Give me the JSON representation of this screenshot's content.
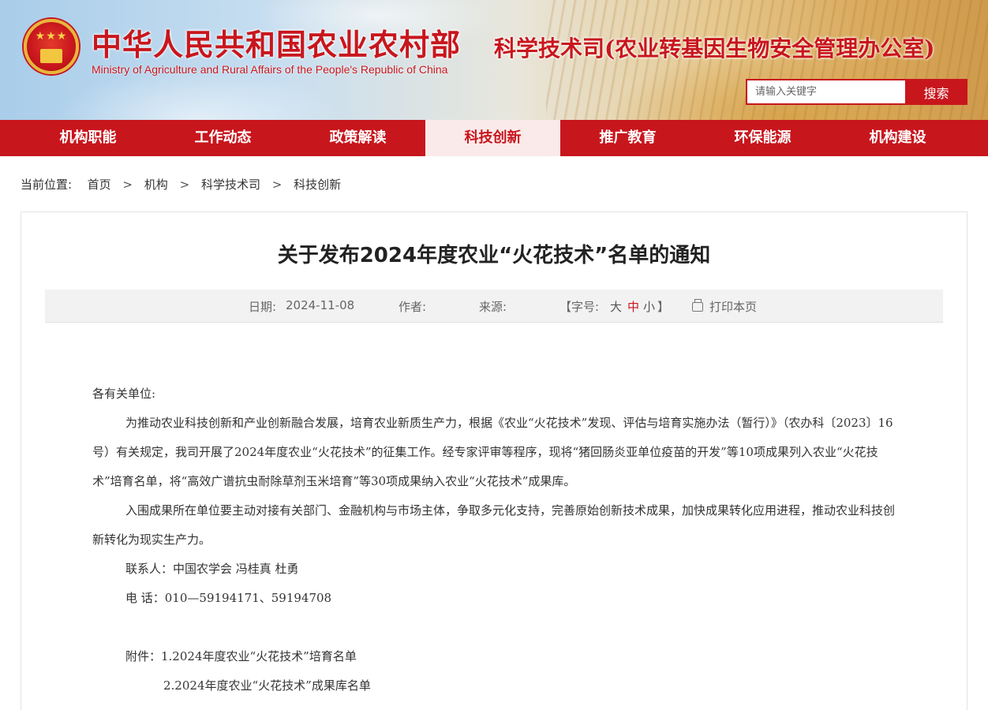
{
  "header": {
    "site_title": "中华人民共和国农业农村部",
    "site_subtitle": "Ministry of Agriculture and Rural Affairs of the People's Republic of China",
    "dept_title": "科学技术司(农业转基因生物安全管理办公室)",
    "search": {
      "placeholder": "请输入关键字",
      "button_label": "搜索"
    }
  },
  "nav": {
    "items": [
      {
        "label": "机构职能"
      },
      {
        "label": "工作动态"
      },
      {
        "label": "政策解读"
      },
      {
        "label": "科技创新",
        "active": true
      },
      {
        "label": "推广教育"
      },
      {
        "label": "环保能源"
      },
      {
        "label": "机构建设"
      }
    ]
  },
  "breadcrumb": {
    "prefix": "当前位置:",
    "items": [
      "首页",
      "机构",
      "科学技术司",
      "科技创新"
    ],
    "separator": ">"
  },
  "article": {
    "title": "关于发布2024年度农业“火花技术”名单的通知",
    "meta": {
      "date_label": "日期:",
      "date": "2024-11-08",
      "author_label": "作者:",
      "source_label": "来源:",
      "font_size_open": "【字号:",
      "size_large": "大",
      "size_medium": "中",
      "size_small": "小",
      "font_size_close": "】",
      "print_label": "打印本页"
    },
    "salutation": "各有关单位:",
    "paragraph1": "为推动农业科技创新和产业创新融合发展，培育农业新质生产力，根据《农业“火花技术”发现、评估与培育实施办法（暂行）》（农办科〔2023〕16号）有关规定，我司开展了2024年度农业“火花技术”的征集工作。经专家评审等程序，现将“猪回肠炎亚单位疫苗的开发”等10项成果列入农业“火花技术”培育名单，将“高效广谱抗虫耐除草剂玉米培育”等30项成果纳入农业“火花技术”成果库。",
    "paragraph2": "入围成果所在单位要主动对接有关部门、金融机构与市场主体，争取多元化支持，完善原始创新技术成果，加快成果转化应用进程，推动农业科技创新转化为现实生产力。",
    "contact": "联系人：中国农学会  冯桂真  杜勇",
    "phone": "电  话：010—59194171、59194708",
    "attachment1": "附件：1.2024年度农业“火花技术”培育名单",
    "attachment2": "2.2024年度农业“火花技术”成果库名单"
  },
  "colors": {
    "brand_red": "#c8161d",
    "nav_active_bg": "#fbeaea",
    "meta_bg": "#f2f2f2"
  }
}
